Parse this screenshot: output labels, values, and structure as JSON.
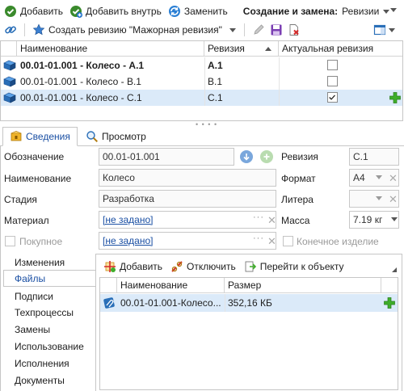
{
  "toolbar1": {
    "add": "Добавить",
    "add_inside": "Добавить внутрь",
    "replace": "Заменить",
    "create_replace_label": "Создание и замена:",
    "create_replace_value": "Ревизии"
  },
  "toolbar2": {
    "create_revision": "Создать ревизию \"Мажорная ревизия\""
  },
  "grid": {
    "columns": [
      "Наименование",
      "Ревизия",
      "Актуальная ревизия"
    ],
    "rows": [
      {
        "name": "00.01-01.001 - Колесо - А.1",
        "revision": "А.1",
        "actual": false
      },
      {
        "name": "00.01-01.001 - Колесо - В.1",
        "revision": "В.1",
        "actual": false
      },
      {
        "name": "00.01-01.001 - Колесо - С.1",
        "revision": "С.1",
        "actual": true
      }
    ]
  },
  "tabs": [
    "Сведения",
    "Просмотр"
  ],
  "form": {
    "designation_label": "Обозначение",
    "designation_value": "00.01-01.001",
    "name_label": "Наименование",
    "name_value": "Колесо",
    "stage_label": "Стадия",
    "stage_value": "Разработка",
    "material_label": "Материал",
    "material_value": "[не задано]",
    "purchased_label": "Покупное",
    "purchased_value": "[не задано]",
    "revision_label": "Ревизия",
    "revision_value": "С.1",
    "format_label": "Формат",
    "format_value": "А4",
    "litera_label": "Литера",
    "litera_value": "",
    "mass_label": "Масса",
    "mass_value": "7.19 кг",
    "final_product_label": "Конечное изделие"
  },
  "side_nav": [
    "Изменения",
    "Файлы",
    "Подписи",
    "Техпроцессы",
    "Замены",
    "Использование",
    "Исполнения",
    "Документы"
  ],
  "files": {
    "add": "Добавить",
    "detach": "Отключить",
    "goto": "Перейти к объекту",
    "columns": [
      "Наименование",
      "Размер"
    ],
    "rows": [
      {
        "name": "00.01-01.001-Колесо...",
        "size": "352,16 КБ"
      }
    ]
  },
  "colors": {
    "selection": "#dbeaf9",
    "accent": "#1a4fa3",
    "plus_green": "#3fae2a"
  }
}
